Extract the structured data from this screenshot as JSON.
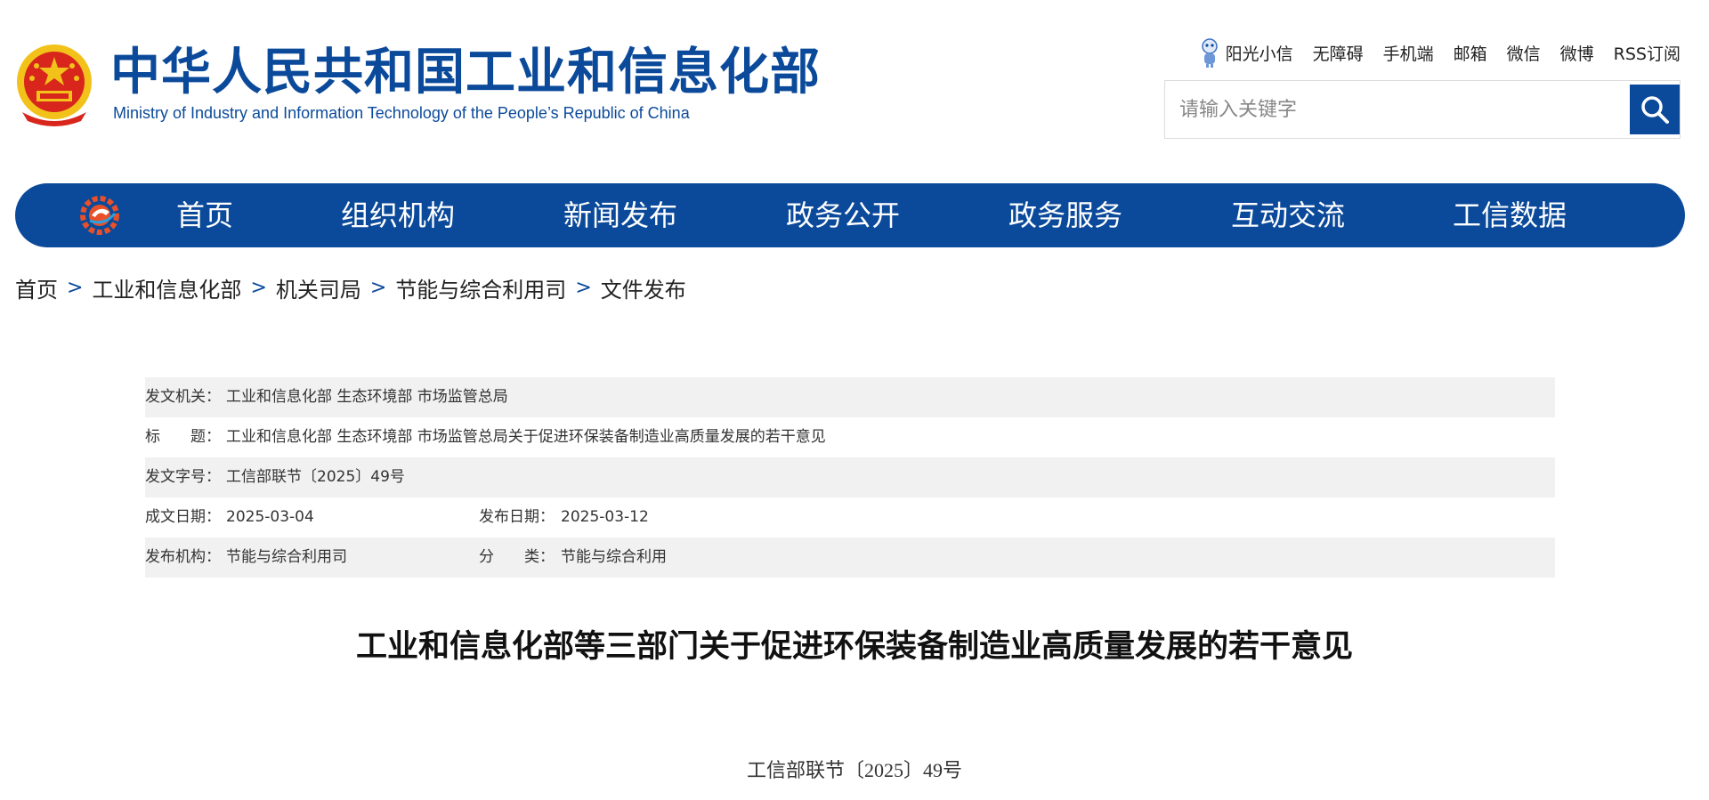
{
  "header": {
    "site_title": "中华人民共和国工业和信息化部",
    "site_subtitle": "Ministry of Industry and Information Technology of the People’s Republic of China",
    "top_links": [
      "阳光小信",
      "无障碍",
      "手机端",
      "邮箱",
      "微信",
      "微博",
      "RSS订阅"
    ],
    "search": {
      "placeholder": "请输入关键字"
    }
  },
  "nav": {
    "items": [
      "首页",
      "组织机构",
      "新闻发布",
      "政务公开",
      "政务服务",
      "互动交流",
      "工信数据"
    ]
  },
  "breadcrumb": {
    "items": [
      "首页",
      "工业和信息化部",
      "机关司局",
      "节能与综合利用司",
      "文件发布"
    ],
    "separator": ">"
  },
  "info": {
    "issuer_label": "发文机关：",
    "issuer_value": "工业和信息化部 生态环境部 市场监管总局",
    "title_label": "标　　题：",
    "title_value": "工业和信息化部 生态环境部 市场监管总局关于促进环保装备制造业高质量发展的若干意见",
    "docno_label": "发文字号：",
    "docno_value": "工信部联节〔2025〕49号",
    "written_label": "成文日期：",
    "written_value": "2025-03-04",
    "published_label": "发布日期：",
    "published_value": "2025-03-12",
    "org_label": "发布机构：",
    "org_value": "节能与综合利用司",
    "category_label": "分　　类：",
    "category_value": "节能与综合利用"
  },
  "article": {
    "title": "工业和信息化部等三部门关于促进环保装备制造业高质量发展的若干意见",
    "doc_number": "工信部联节〔2025〕49号"
  },
  "colors": {
    "brand_blue": "#0b4a9a",
    "shade_row": "#f1f1f1",
    "emblem_red": "#d8261c",
    "emblem_gold": "#f2c21a"
  }
}
